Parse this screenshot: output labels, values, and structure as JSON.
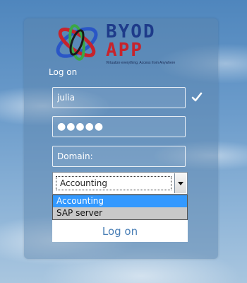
{
  "logo": {
    "brand_top": "BYOD",
    "brand_bottom": "APP",
    "tagline": "Virtualize everything, Access from Anywhere"
  },
  "form": {
    "heading": "Log on",
    "username": {
      "value": "julia"
    },
    "password": {
      "value": "●●●●●"
    },
    "domain": {
      "placeholder": "Domain:",
      "value": ""
    },
    "server_select": {
      "selected": "Accounting",
      "options": [
        "Accounting",
        "SAP server"
      ],
      "highlighted": "Accounting"
    },
    "submit_label": "Log on"
  },
  "icons": {
    "username_valid": "checkmark-icon",
    "logo_mark": "globe-swirl-icon"
  },
  "colors": {
    "brand_blue": "#1e3b8a",
    "brand_red": "#c7232c",
    "dropdown_highlight": "#3399ff",
    "button_text": "#4a7fb6"
  }
}
